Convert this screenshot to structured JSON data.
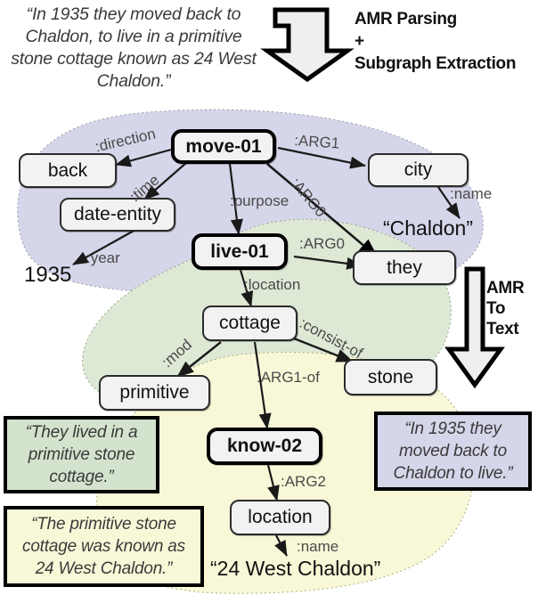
{
  "source": {
    "label": "source-sentence",
    "text": "“In 1935 they moved back to Chaldon, to live in a primitive stone cottage known as 24 West Chaldon.”"
  },
  "process": {
    "parsing": {
      "line1": "AMR Parsing",
      "line2": "+",
      "line3": "Subgraph Extraction",
      "arrow_icon": "elbow-down-arrow-icon"
    },
    "amr_to_text": {
      "line1": "AMR",
      "line2": "To",
      "line3": "Text",
      "arrow_icon": "down-arrow-icon"
    }
  },
  "graph": {
    "nodes": [
      {
        "id": "move",
        "label": "move-01",
        "kind": "predicate"
      },
      {
        "id": "back",
        "label": "back",
        "kind": "concept"
      },
      {
        "id": "date",
        "label": "date-entity",
        "kind": "concept"
      },
      {
        "id": "city",
        "label": "city",
        "kind": "concept"
      },
      {
        "id": "live",
        "label": "live-01",
        "kind": "predicate"
      },
      {
        "id": "they",
        "label": "they",
        "kind": "concept"
      },
      {
        "id": "cottage",
        "label": "cottage",
        "kind": "concept"
      },
      {
        "id": "primitive",
        "label": "primitive",
        "kind": "concept"
      },
      {
        "id": "stone",
        "label": "stone",
        "kind": "concept"
      },
      {
        "id": "know",
        "label": "know-02",
        "kind": "predicate"
      },
      {
        "id": "location",
        "label": "location",
        "kind": "concept"
      }
    ],
    "literals": [
      {
        "id": "year1935",
        "text": "1935"
      },
      {
        "id": "chaldon",
        "text": "“Chaldon”"
      },
      {
        "id": "address",
        "text": "“24 West Chaldon”"
      }
    ],
    "edges": [
      {
        "from": "move",
        "to": "back",
        "label": ":direction"
      },
      {
        "from": "move",
        "to": "date",
        "label": ":time"
      },
      {
        "from": "move",
        "to": "city",
        "label": ":ARG1"
      },
      {
        "from": "move",
        "to": "live",
        "label": ":purpose"
      },
      {
        "from": "move",
        "to": "they",
        "label": ":ARG0"
      },
      {
        "from": "date",
        "to": "year1935",
        "label": ":year"
      },
      {
        "from": "city",
        "to": "chaldon",
        "label": ":name"
      },
      {
        "from": "live",
        "to": "they",
        "label": ":ARG0"
      },
      {
        "from": "live",
        "to": "cottage",
        "label": ":location"
      },
      {
        "from": "cottage",
        "to": "primitive",
        "label": ":mod"
      },
      {
        "from": "cottage",
        "to": "stone",
        "label": ":consist-of"
      },
      {
        "from": "cottage",
        "to": "know",
        "label": ":ARG1-of"
      },
      {
        "from": "know",
        "to": "location",
        "label": ":ARG2"
      },
      {
        "from": "location",
        "to": "address",
        "label": ":name"
      }
    ],
    "subgraph_regions": [
      {
        "id": "region-purple",
        "color": "#d6d6ea"
      },
      {
        "id": "region-green",
        "color": "#dde8d5"
      },
      {
        "id": "region-yellow",
        "color": "#f8f8d8"
      }
    ]
  },
  "outputs": [
    {
      "id": "out-green",
      "region": "region-green",
      "color": "#d4e3cd",
      "text": "“They lived in a primitive stone cottage.”"
    },
    {
      "id": "out-yellow",
      "region": "region-yellow",
      "color": "#f8f8d8",
      "text": "“The primitive stone cottage was known as 24 West Chaldon.”"
    },
    {
      "id": "out-purple",
      "region": "region-purple",
      "color": "#d6d6ea",
      "text": "“In 1935 they moved back to Chaldon to live.”"
    }
  ]
}
